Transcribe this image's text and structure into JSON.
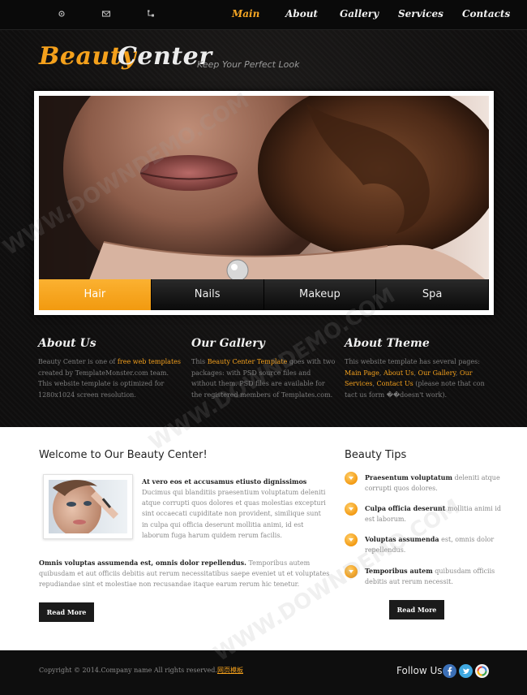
{
  "nav": {
    "icons": [
      "home-icon",
      "mail-icon",
      "sitemap-icon"
    ],
    "items": [
      {
        "label": "Main",
        "active": true
      },
      {
        "label": "About"
      },
      {
        "label": "Gallery"
      },
      {
        "label": "Services"
      },
      {
        "label": "Contacts"
      }
    ]
  },
  "logo": {
    "word1": "Beauty",
    "word2": "Center",
    "slogan": "Keep Your Perfect Look"
  },
  "slider": {
    "tabs": [
      {
        "label": "Hair",
        "active": true
      },
      {
        "label": "Nails"
      },
      {
        "label": "Makeup"
      },
      {
        "label": "Spa"
      }
    ]
  },
  "columns": {
    "about": {
      "title": "About Us",
      "t1": "Beauty Center is one of ",
      "link": "free web templates",
      "t2": " created by TemplateMonster.com team. This website template is optimized for 1280x1024 screen resolution."
    },
    "gallery": {
      "title": "Our Gallery",
      "t1": "This ",
      "link": "Beauty Center Template",
      "t2": " goes with two packages: with PSD source files and without them. PSD files are available for the registered members of Templates.com."
    },
    "theme": {
      "title": "About Theme",
      "t1": "This website template has several pages: ",
      "link1": "Main Page",
      "s1": ", ",
      "link2": "About Us",
      "s2": ", ",
      "link3": "Our Gallery",
      "s3": ", ",
      "link4": "Our Services",
      "s4": ", ",
      "link5": "Contact Us",
      "t2": " (please note that con tact us form ��doesn't work)."
    }
  },
  "welcome": {
    "title": "Welcome to Our Beauty Center!",
    "intro_heading": "At vero eos et accusamus etiusto dignissimos",
    "intro_text": "Ducimus qui blanditiis praesentium voluptatum deleniti atque corrupti quos dolores et quas molestias excepturi sint occaecati cupiditate non provident, similique sunt in culpa qui officia deserunt mollitia animi, id est laborum fuga harum quidem rerum facilis.",
    "para2_bold": "Omnis voluptas assumenda est, omnis dolor repellendus.",
    "para2_text": " Temporibus autem quibusdam et aut officiis debitis aut rerum necessitatibus saepe eveniet ut et voluptates repudiandae sint et molestiae non recusandae itaque earum rerum hic tenetur.",
    "read_more": "Read More"
  },
  "tips": {
    "title": "Beauty Tips",
    "items": [
      {
        "bold": "Praesentum voluptatum",
        "text": " deleniti atque corrupti quos dolores."
      },
      {
        "bold": "Culpa officia deserunt",
        "text": " mollitia animi id est laborum."
      },
      {
        "bold": "Voluptas assumenda",
        "text": " est, omnis dolor repellendus."
      },
      {
        "bold": "Temporibus autem",
        "text": " quibusdam officiis debitis aut rerum necessit."
      }
    ],
    "read_more": "Read More"
  },
  "footer": {
    "copyright": "Copyright © 2014.Company name All rights reserved.",
    "cn_link": "网页模板",
    "follow": "Follow Us:",
    "social": [
      "facebook-icon",
      "twitter-icon",
      "google-icon"
    ]
  },
  "watermark": "WWW.DOWNDEMO.COM",
  "colors": {
    "accent": "#f5a11c",
    "dark_bg": "#131212",
    "footer_bg": "#0e0e0e"
  }
}
